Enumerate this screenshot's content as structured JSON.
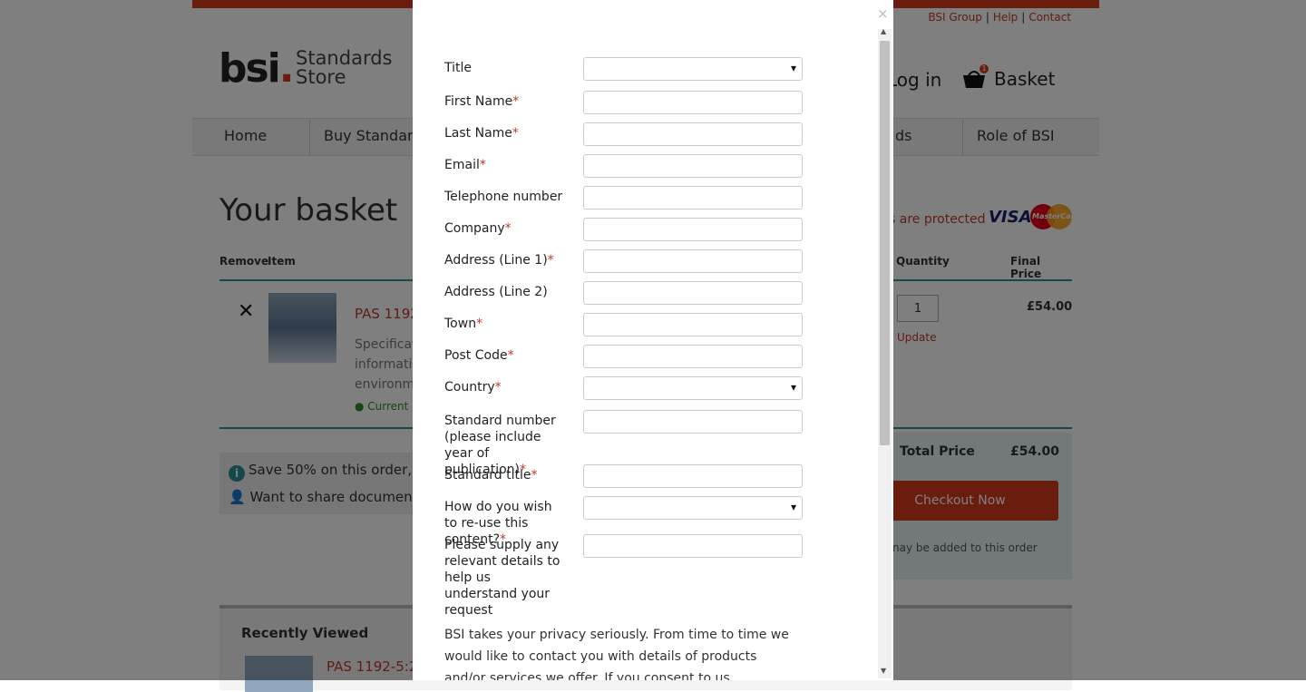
{
  "toplinks": [
    "BSI Group",
    "Help",
    "Contact"
  ],
  "logo": {
    "bsi": "bsi",
    "dot": ".",
    "store": "Standards Store"
  },
  "header": {
    "login": "Log in",
    "basket": "Basket",
    "basket_count": "1"
  },
  "nav": [
    "Home",
    "Buy Standards",
    "ds",
    "Role of BSI"
  ],
  "basket_page": {
    "heading": "Your basket",
    "secure_text": "s are protected",
    "visa": "VISA",
    "mastercard": "MasterCard",
    "columns": {
      "remove": "Remove",
      "item": "Item",
      "quantity": "Quantity",
      "final_price": "Final Price"
    },
    "item": {
      "title": "PAS 1192-",
      "desc": "Specificat information environme",
      "status": "Current (",
      "qty": "1",
      "update": "Update",
      "price": "£54.00"
    },
    "promo1": "Save 50% on this order,",
    "promo2": "Want to share document",
    "total_label": "Total Price",
    "total_value": "£54.00",
    "checkout": "Checkout Now",
    "note": "nay be added to this order",
    "recent_title": "Recently Viewed",
    "recent_item": "PAS 1192-5:20"
  },
  "modal": {
    "close": "×",
    "fields": [
      {
        "label": "Title",
        "required": false,
        "type": "select"
      },
      {
        "label": "First Name",
        "required": true,
        "type": "text"
      },
      {
        "label": "Last Name",
        "required": true,
        "type": "text"
      },
      {
        "label": "Email",
        "required": true,
        "type": "text"
      },
      {
        "label": "Telephone number",
        "required": false,
        "type": "text"
      },
      {
        "label": "Company",
        "required": true,
        "type": "text"
      },
      {
        "label": "Address (Line 1)",
        "required": true,
        "type": "text"
      },
      {
        "label": "Address (Line 2)",
        "required": false,
        "type": "text"
      },
      {
        "label": "Town",
        "required": true,
        "type": "text"
      },
      {
        "label": "Post Code",
        "required": true,
        "type": "text"
      },
      {
        "label": "Country",
        "required": true,
        "type": "select"
      },
      {
        "label": "Standard number (please include year of publication)",
        "required": true,
        "type": "text"
      },
      {
        "label": "Standard title",
        "required": true,
        "type": "text"
      },
      {
        "label": "How do you wish to re-use this content?",
        "required": true,
        "type": "select"
      },
      {
        "label": "Please supply any relevant details to help us understand your request",
        "required": false,
        "type": "text"
      }
    ],
    "privacy": "BSI takes your privacy seriously. From time to time we would like to contact you with details of products and/or services we offer. If you consent to us contacting you for this"
  },
  "colors": {
    "accent": "#d4391b",
    "teal": "#2a8f9b",
    "required": "#c0392b"
  }
}
